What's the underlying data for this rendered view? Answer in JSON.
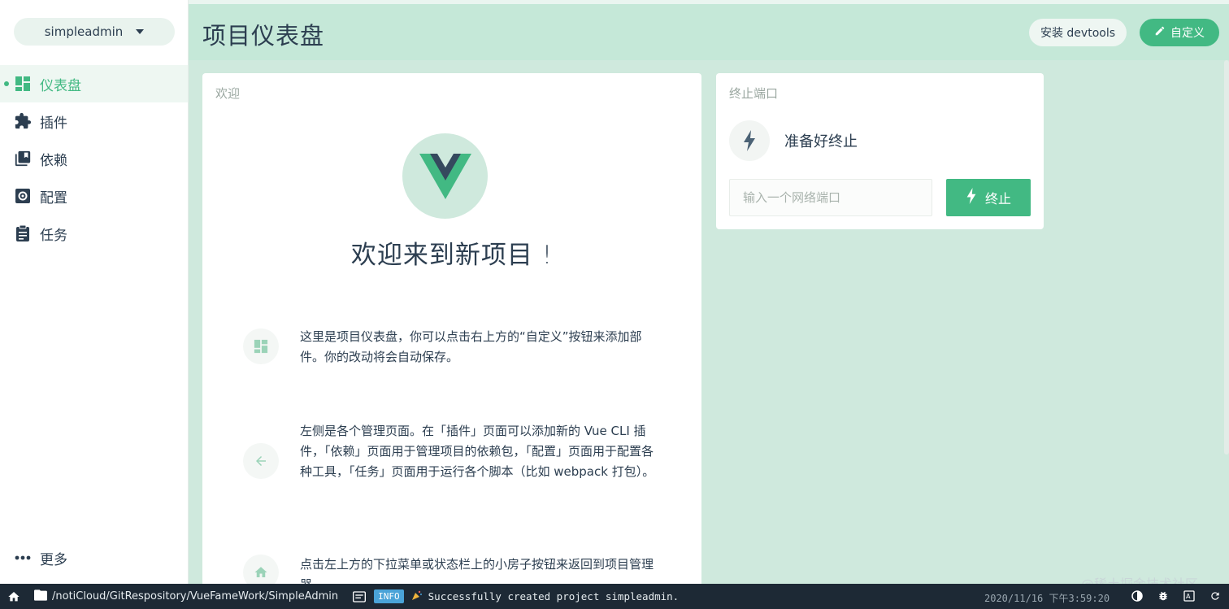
{
  "project_selector": {
    "label": "simpleadmin"
  },
  "sidebar": {
    "items": [
      {
        "label": "仪表盘",
        "icon": "dashboard-icon",
        "active": true
      },
      {
        "label": "插件",
        "icon": "puzzle-icon",
        "active": false
      },
      {
        "label": "依赖",
        "icon": "library-icon",
        "active": false
      },
      {
        "label": "配置",
        "icon": "gear-icon",
        "active": false
      },
      {
        "label": "任务",
        "icon": "clipboard-icon",
        "active": false
      }
    ],
    "more_label": "更多"
  },
  "header": {
    "title": "项目仪表盘",
    "devtools_label": "安装 devtools",
    "customize_label": "自定义"
  },
  "welcome_card": {
    "title": "欢迎",
    "heading": "欢迎来到新项目 !",
    "tips": [
      {
        "icon": "dashboard-icon",
        "text": "这里是项目仪表盘，你可以点击右上方的“自定义”按钮来添加部件。你的改动将会自动保存。"
      },
      {
        "icon": "arrow-left-icon",
        "text": "左侧是各个管理页面。在「插件」页面可以添加新的 Vue CLI 插件，「依赖」页面用于管理项目的依赖包，「配置」页面用于配置各种工具，「任务」页面用于运行各个脚本（比如 webpack 打包）。"
      },
      {
        "icon": "home-icon",
        "text": "点击左上方的下拉菜单或状态栏上的小房子按钮来返回到项目管理器。"
      }
    ]
  },
  "kill_port_card": {
    "title": "终止端口",
    "status": "准备好终止",
    "input_placeholder": "输入一个网络端口",
    "button_label": "终止"
  },
  "statusbar": {
    "path": "/notiCloud/GitRespository/VueFameWork/SimpleAdmin",
    "log_level": "INFO",
    "message": "Successfully created project simpleadmin.",
    "timestamp": "2020/11/16 下午3:59:20"
  },
  "watermark": "@稀土掘金技术社区",
  "colors": {
    "accent": "#42b983",
    "header_bg": "#c5e8d8",
    "statusbar_bg": "#1d2935"
  }
}
